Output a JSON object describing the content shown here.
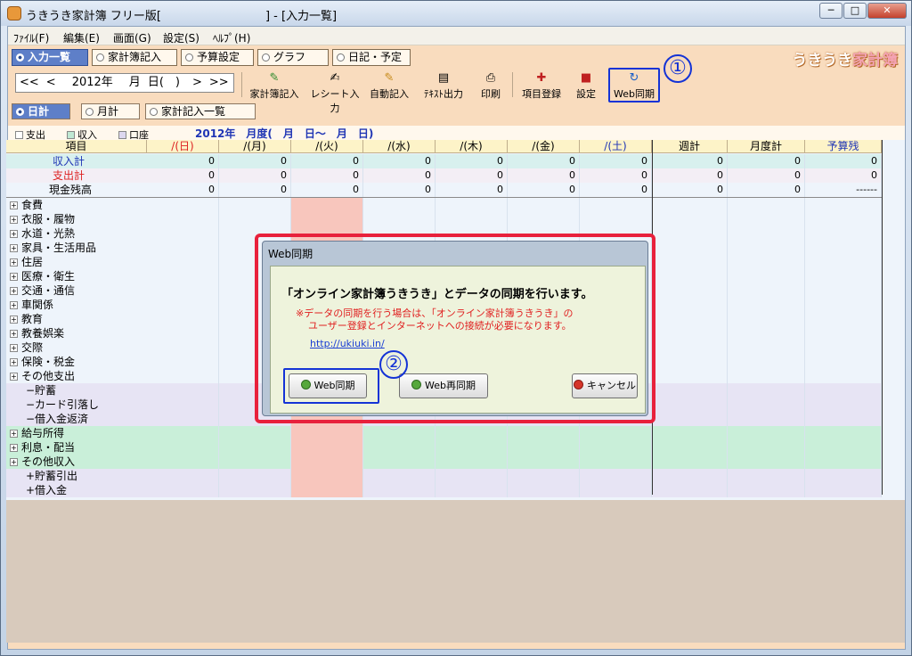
{
  "window": {
    "title": "うきうき家計簿 フリー版[　　　　　　　　　] - [入力一覧]",
    "min": "─",
    "max": "□",
    "close": "✕"
  },
  "menu": [
    "ﾌｧｲﾙ(F)",
    "編集(E)",
    "画面(G)",
    "設定(S)",
    "ﾍﾙﾌﾟ(H)"
  ],
  "tabs": [
    "入力一覧",
    "家計簿記入",
    "予算設定",
    "グラフ",
    "日記・予定"
  ],
  "brand": {
    "a": "うきうき",
    "b": "家計簿"
  },
  "date": {
    "prev2": "<<",
    "prev": "<",
    "year": "2012年",
    "month": "月",
    "day": "日(　)",
    "next": ">",
    "next2": ">>"
  },
  "toolbar": [
    "家計簿記入",
    "レシート入力",
    "自動記入",
    "ﾃｷｽﾄ出力",
    "印刷",
    "項目登録",
    "設定",
    "Web同期"
  ],
  "view_tabs": [
    "日計",
    "月計",
    "家計記入一覧"
  ],
  "legend": [
    "支出",
    "収入",
    "口座"
  ],
  "period": "2012年　月度(　月　日〜　月　日)",
  "headers": [
    "項目",
    "/(日)",
    "/(月)",
    "/(火)",
    "/(水)",
    "/(木)",
    "/(金)",
    "/(土)",
    "週計",
    "月度計",
    "予算残"
  ],
  "summary_rows": [
    {
      "label": "収入計",
      "values": [
        "0",
        "0",
        "0",
        "0",
        "0",
        "0",
        "0",
        "0",
        "0",
        "0"
      ]
    },
    {
      "label": "支出計",
      "values": [
        "0",
        "0",
        "0",
        "0",
        "0",
        "0",
        "0",
        "0",
        "0",
        "0"
      ]
    },
    {
      "label": "現金残高",
      "values": [
        "0",
        "0",
        "0",
        "0",
        "0",
        "0",
        "0",
        "0",
        "0",
        "------"
      ]
    }
  ],
  "categories": [
    "食費",
    "衣服・履物",
    "水道・光熱",
    "家具・生活用品",
    "住居",
    "医療・衛生",
    "交通・通信",
    "車関係",
    "教育",
    "教養娯楽",
    "交際",
    "保険・税金",
    "その他支出",
    "−貯蓄",
    "−カード引落し",
    "−借入金返済",
    "給与所得",
    "利息・配当",
    "その他収入",
    "+貯蓄引出",
    "+借入金"
  ],
  "dialog": {
    "title": "Web同期",
    "message": "「オンライン家計簿うきうき」とデータの同期を行います。",
    "note1": "※データの同期を行う場合は、「オンライン家計簿うきうき」の",
    "note2": "ユーザー登録とインターネットへの接続が必要になります。",
    "link": "http://ukiuki.in/",
    "btn_sync": "Web同期",
    "btn_resync": "Web再同期",
    "btn_cancel": "キャンセル"
  },
  "annotations": [
    "①",
    "②"
  ]
}
